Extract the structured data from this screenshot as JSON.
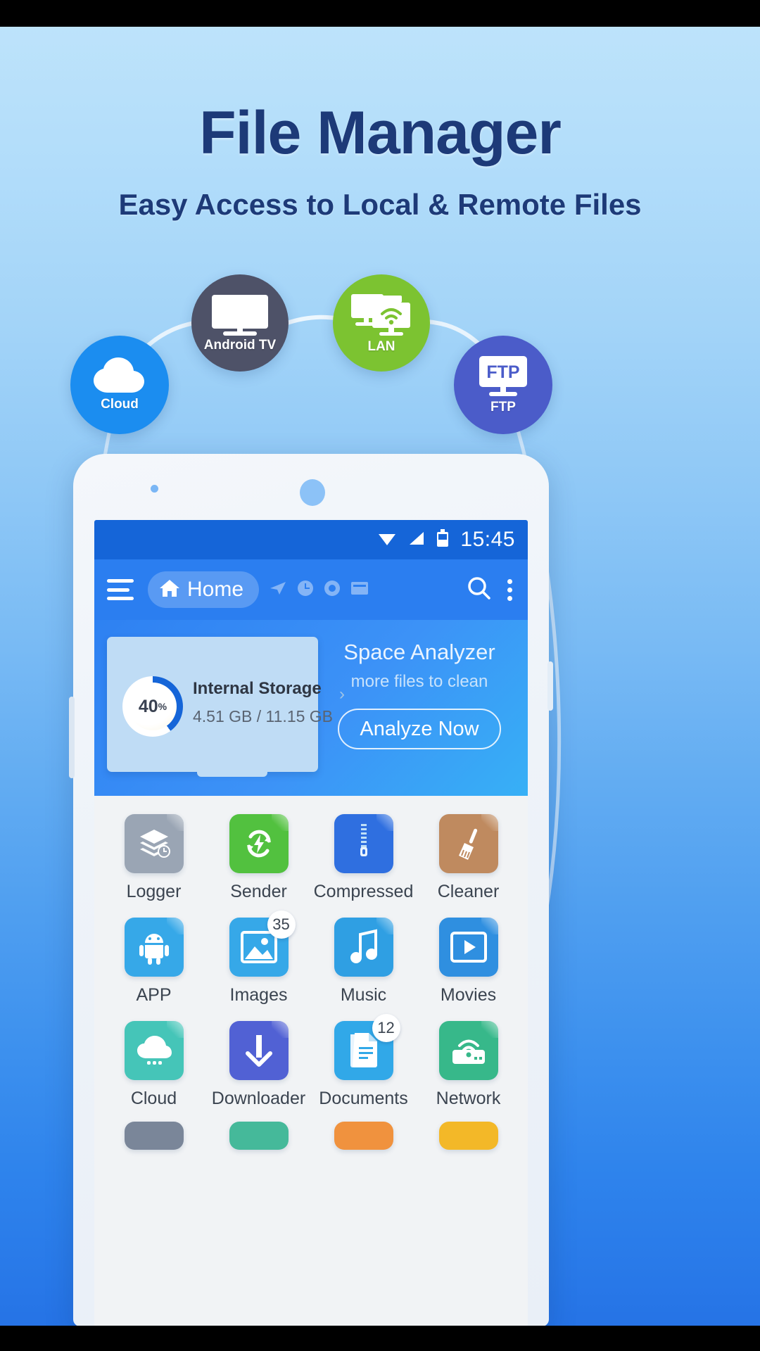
{
  "hero": {
    "title": "File Manager",
    "subtitle": "Easy Access to Local & Remote Files",
    "title_color": "#1d3a78"
  },
  "badges": [
    {
      "id": "cloud",
      "label": "Cloud",
      "icon": "cloud-icon",
      "color": "#1b8df0"
    },
    {
      "id": "tv",
      "label": "Android TV",
      "icon": "tv-icon",
      "color": "#4e5268"
    },
    {
      "id": "lan",
      "label": "LAN",
      "icon": "lan-wifi-icon",
      "color": "#7cc331"
    },
    {
      "id": "ftp",
      "label": "FTP",
      "icon": "ftp-monitor-icon",
      "color": "#4b5cc9",
      "screen_text": "FTP"
    }
  ],
  "phone": {
    "statusbar": {
      "time": "15:45",
      "icons": [
        "wifi-icon",
        "signal-icon",
        "battery-icon"
      ]
    },
    "toolbar": {
      "menu_icon": "hamburger-icon",
      "home_label": "Home",
      "home_icon": "house-icon",
      "faded_icons": [
        "send-icon",
        "clock-icon",
        "recent-icon",
        "window-icon"
      ],
      "search_icon": "search-icon",
      "overflow_icon": "more-vertical-icon"
    },
    "analyzer": {
      "storage_name": "Internal Storage",
      "storage_used": "4.51 GB / 11.15 GB",
      "percent": "40",
      "percent_suffix": "%",
      "title": "Space Analyzer",
      "subtitle": "more files to clean",
      "button": "Analyze Now"
    },
    "grid": [
      {
        "name": "Logger",
        "icon": "layers-clock-icon",
        "color": "#9aa5b4",
        "badge": ""
      },
      {
        "name": "Sender",
        "icon": "sync-bolt-icon",
        "color": "#52c13f",
        "badge": ""
      },
      {
        "name": "Compressed",
        "icon": "zip-icon",
        "color": "#2f6fe0",
        "badge": ""
      },
      {
        "name": "Cleaner",
        "icon": "broom-icon",
        "color": "#bf8a5f",
        "badge": ""
      },
      {
        "name": "APP",
        "icon": "android-icon",
        "color": "#36a8e8",
        "badge": ""
      },
      {
        "name": "Images",
        "icon": "picture-icon",
        "color": "#36a8e8",
        "badge": "35"
      },
      {
        "name": "Music",
        "icon": "note-icon",
        "color": "#2f9fe3",
        "badge": ""
      },
      {
        "name": "Movies",
        "icon": "play-icon",
        "color": "#2f8fe0",
        "badge": ""
      },
      {
        "name": "Cloud",
        "icon": "cloud-dots-icon",
        "color": "#45c5b8",
        "badge": ""
      },
      {
        "name": "Downloader",
        "icon": "arrow-down-icon",
        "color": "#5161d4",
        "badge": ""
      },
      {
        "name": "Documents",
        "icon": "document-icon",
        "color": "#31a8e8",
        "badge": "12"
      },
      {
        "name": "Network",
        "icon": "network-wifi-icon",
        "color": "#37b88a",
        "badge": ""
      }
    ],
    "grid_partial_colors": [
      "#7a8699",
      "#45b99a",
      "#f0923e",
      "#f3b828"
    ]
  }
}
